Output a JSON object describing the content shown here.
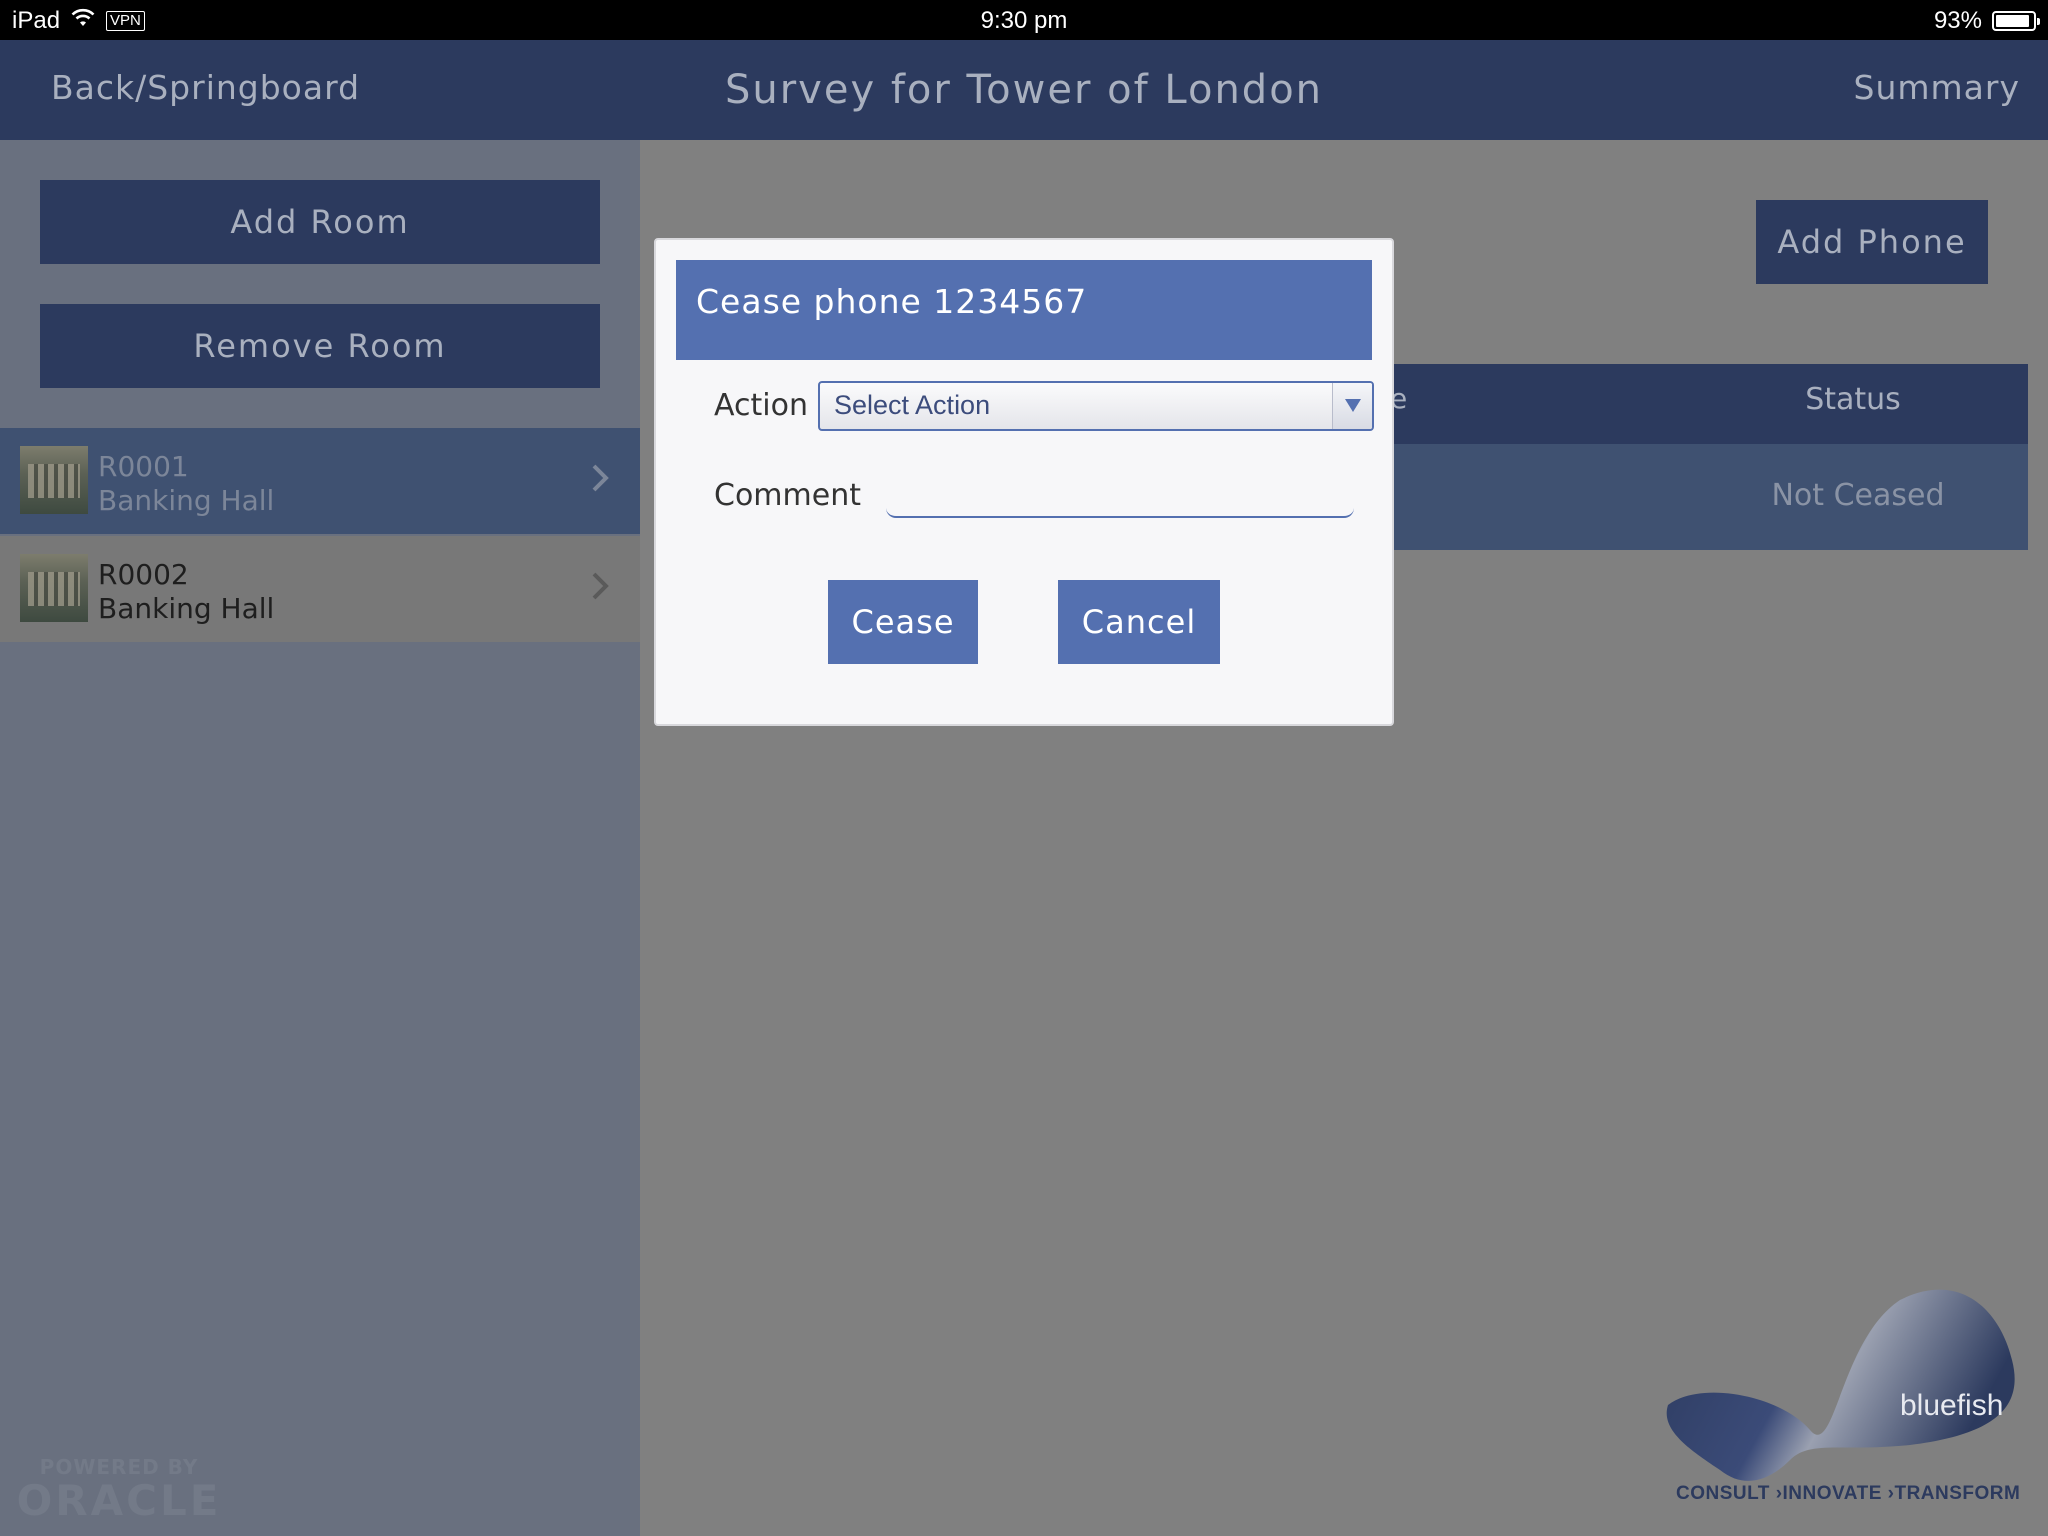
{
  "status_bar": {
    "device": "iPad",
    "vpn": "VPN",
    "time": "9:30 pm",
    "battery": "93%",
    "battery_level": 0.93
  },
  "header": {
    "back_label": "Back/Springboard",
    "title": "Survey for Tower of London",
    "summary_label": "Summary"
  },
  "sidebar": {
    "add_room_label": "Add Room",
    "remove_room_label": "Remove Room",
    "rooms": [
      {
        "code": "R0001",
        "name": "Banking Hall",
        "selected": true
      },
      {
        "code": "R0002",
        "name": "Banking Hall",
        "selected": false
      }
    ],
    "powered_by": "POWERED BY",
    "oracle": "ORACLE"
  },
  "main": {
    "add_phone_label": "Add Phone",
    "table": {
      "partial_header": "e",
      "status_header": "Status",
      "rows": [
        {
          "status": "Not Ceased"
        }
      ]
    },
    "brand": {
      "name": "bluefish",
      "tagline": "CONSULT ›INNOVATE ›TRANSFORM"
    }
  },
  "dialog": {
    "title": "Cease phone 1234567",
    "action_label": "Action",
    "action_value": "Select Action",
    "comment_label": "Comment",
    "comment_value": "",
    "cease_label": "Cease",
    "cancel_label": "Cancel"
  },
  "colors": {
    "header_navy": "#2c3a5e",
    "dialog_blue": "#5470b0",
    "selected_row": "#3f5171"
  }
}
